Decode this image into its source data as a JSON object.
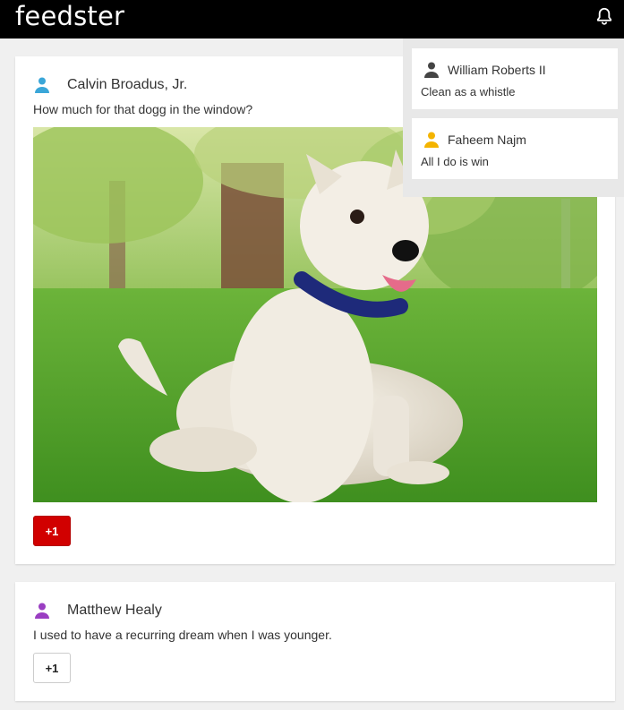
{
  "app": {
    "brand": "feedster"
  },
  "header": {
    "notifications_icon": "bell-icon"
  },
  "posts": [
    {
      "author": "Calvin Broadus, Jr.",
      "avatar_color": "#3aa6d8",
      "text": "How much for that dogg in the window?",
      "image": "west-highland-terrier-on-grass",
      "plus_label": "+1",
      "plus_active": true
    },
    {
      "author": "Matthew Healy",
      "avatar_color": "#9a3ec2",
      "text": "I used to have a recurring dream when I was younger.",
      "plus_label": "+1",
      "plus_active": false
    }
  ],
  "notifications": [
    {
      "name": "William Roberts II",
      "avatar_color": "#444444",
      "message": "Clean as a whistle"
    },
    {
      "name": "Faheem Najm",
      "avatar_color": "#f4b400",
      "message": "All I do is win"
    }
  ],
  "colors": {
    "topbar": "#000000",
    "plus_active": "#d10000"
  }
}
